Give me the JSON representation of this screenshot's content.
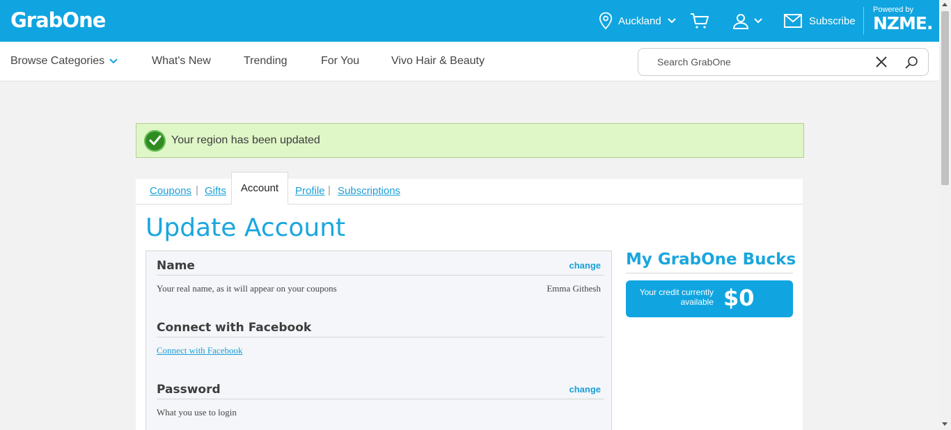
{
  "brand": {
    "logo_text": "GrabOne",
    "powered_by": "Powered by",
    "partner": "NZME."
  },
  "topbar": {
    "location": "Auckland",
    "subscribe": "Subscribe"
  },
  "nav": {
    "browse": "Browse Categories",
    "items": [
      "What's New",
      "Trending",
      "For You",
      "Vivo Hair & Beauty"
    ]
  },
  "search": {
    "placeholder": "Search GrabOne"
  },
  "alert": {
    "message": "Your region has been updated"
  },
  "tabs": {
    "coupons": "Coupons",
    "gifts": "Gifts",
    "account": "Account",
    "profile": "Profile",
    "subscriptions": "Subscriptions",
    "separator": "|"
  },
  "page": {
    "title": "Update Account"
  },
  "sections": {
    "name": {
      "title": "Name",
      "change": "change",
      "description": "Your real name, as it will appear on your coupons",
      "value": "Emma Githesh"
    },
    "facebook": {
      "title": "Connect with Facebook",
      "link": "Connect with Facebook"
    },
    "password": {
      "title": "Password",
      "change": "change",
      "description": "What you use to login"
    }
  },
  "bucks": {
    "title": "My GrabOne Bucks",
    "label": "Your credit currently available",
    "amount": "$0"
  },
  "colors": {
    "brand_blue": "#10a5e0",
    "link_blue": "#1a9fd6",
    "alert_bg": "#dff6c7",
    "check_green": "#2f8c22"
  }
}
